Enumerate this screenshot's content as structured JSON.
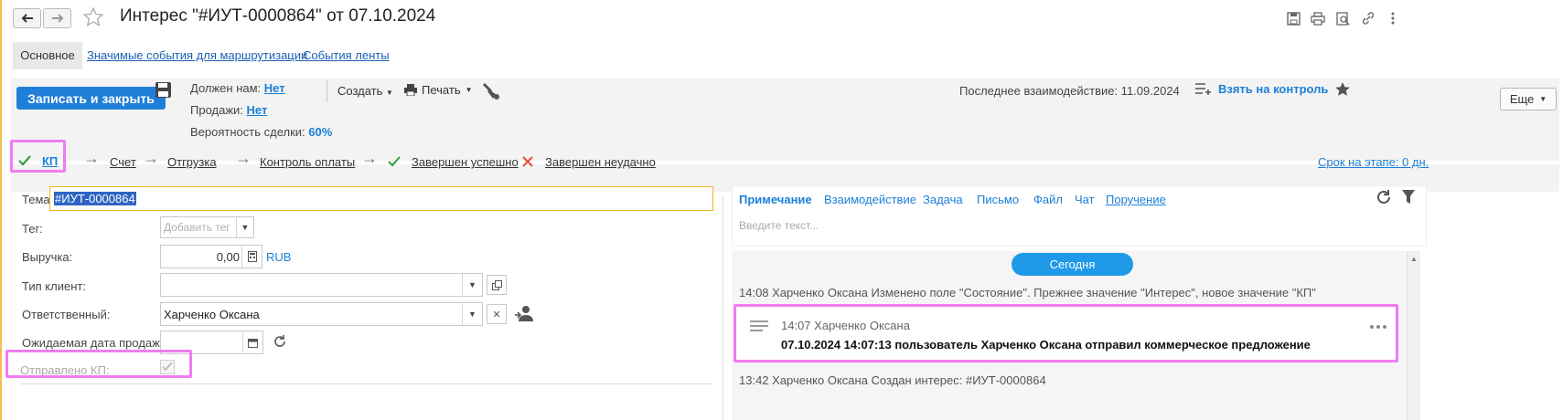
{
  "window": {
    "title": "Интерес \"#ИУТ-0000864\" от 07.10.2024"
  },
  "tabs": [
    {
      "label": "Основное"
    },
    {
      "label": "Значимые события для маршрутизации"
    },
    {
      "label": "События ленты"
    }
  ],
  "toolbar": {
    "save_close": "Записать и закрыть",
    "owes_label": "Должен нам:",
    "owes_value": "Нет",
    "sales_label": "Продажи:",
    "sales_value": "Нет",
    "prob_label": "Вероятность сделки:",
    "prob_value": "60%",
    "create": "Создать",
    "print": "Печать",
    "last_interaction": "Последнее взаимодействие: 11.09.2024",
    "take_control": "Взять на контроль",
    "more": "Еще"
  },
  "stages": {
    "items": [
      {
        "label": "КП"
      },
      {
        "label": "Счет"
      },
      {
        "label": "Отгрузка"
      },
      {
        "label": "Контроль оплаты"
      },
      {
        "label": "Завершен успешно"
      },
      {
        "label": "Завершен неудачно"
      }
    ],
    "deadline": "Срок на этапе: 0 дн."
  },
  "form": {
    "subject_label": "Тема:",
    "subject_value": "#ИУТ-0000864",
    "tag_label": "Тег:",
    "tag_placeholder": "Добавить тег",
    "revenue_label": "Выручка:",
    "revenue_value": "0,00",
    "currency": "RUB",
    "client_type_label": "Тип клиент:",
    "client_type_value": "",
    "responsible_label": "Ответственный:",
    "responsible_value": "Харченко Оксана",
    "expected_date_label": "Ожидаемая дата продажи:",
    "sent_kp_label": "Отправлено КП:"
  },
  "feed": {
    "tabs": [
      {
        "label": "Примечание"
      },
      {
        "label": "Взаимодействие"
      },
      {
        "label": "Задача"
      },
      {
        "label": "Письмо"
      },
      {
        "label": "Файл"
      },
      {
        "label": "Чат"
      },
      {
        "label": "Поручение"
      }
    ],
    "input_placeholder": "Введите текст...",
    "today_label": "Сегодня",
    "entry1": "14:08 Харченко Оксана Изменено поле \"Состояние\". Прежнее значение \"Интерес\", новое значение \"КП\"",
    "entry2_header": "14:07 Харченко Оксана",
    "entry2_text": "07.10.2024 14:07:13 пользователь Харченко Оксана отправил коммерческое предложение",
    "entry3": "13:42 Харченко Оксана Создан интерес: #ИУТ-0000864"
  },
  "colors": {
    "accent": "#1f7fd8",
    "highlight": "#f07cf0",
    "today_pill": "#1f9ae8"
  }
}
